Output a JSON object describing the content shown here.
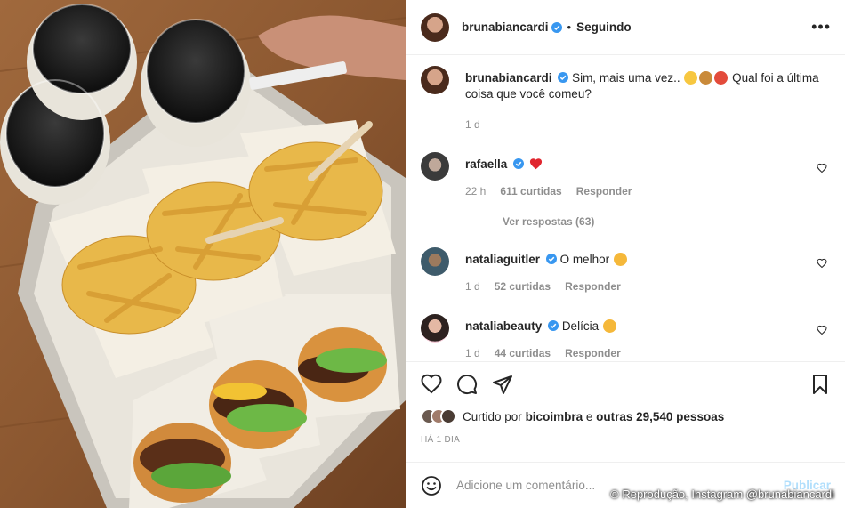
{
  "post": {
    "author": "bruna­biancardi",
    "follow_status": "Seguindo",
    "more": "•••"
  },
  "caption": {
    "username": "brunabiancardi",
    "text_before": "Sim, mais uma vez..",
    "text_after": "Qual foi a última coisa que você comeu?",
    "time": "1 d"
  },
  "comments": [
    {
      "username": "rafaella",
      "text": "",
      "time": "22 h",
      "likes": "611 curtidas",
      "reply": "Responder"
    },
    {
      "username": "nataliaguitler",
      "text": "O melhor",
      "time": "1 d",
      "likes": "52 curtidas",
      "reply": "Responder"
    },
    {
      "username": "nataliabeauty",
      "text": "Delícia",
      "time": "1 d",
      "likes": "44 curtidas",
      "reply": "Responder"
    }
  ],
  "view_replies": "Ver respostas (63)",
  "likes": {
    "prefix": "Curtido por",
    "user": "bicoimbra",
    "middle": "e",
    "others": "outras 29,540 pessoas"
  },
  "posted_ago": "HÁ 1 DIA",
  "composer": {
    "placeholder": "Adicione um comentário...",
    "publish": "Publicar"
  },
  "watermark": "© Reprodução, Instagram @brunabiancardi",
  "colors": {
    "verified": "#3897f0",
    "heart_red": "#ed4956",
    "muted": "#8e8e8e"
  }
}
